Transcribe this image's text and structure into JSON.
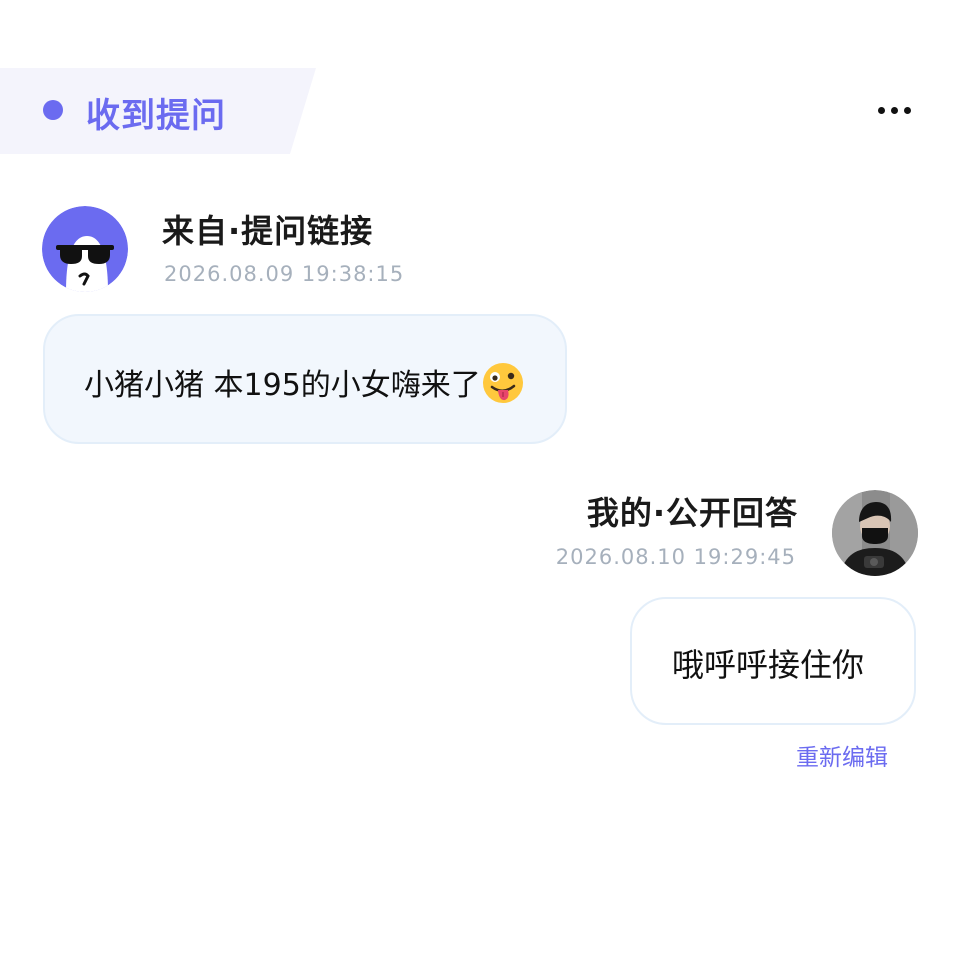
{
  "header": {
    "title": "收到提问",
    "more_icon": "more-horizontal-icon"
  },
  "question": {
    "from_label": "来自·提问链接",
    "timestamp": "2026.08.09 19:38:15",
    "text": "小猪小猪 本195的小女嗨来了",
    "emoji": "zany-face-tongue-emoji",
    "avatar": "cartoon-sunglasses-avatar"
  },
  "answer": {
    "label": "我的·公开回答",
    "timestamp": "2026.08.10 19:29:45",
    "text": "哦呼呼接住你",
    "avatar": "user-photo-avatar",
    "reedit_label": "重新编辑"
  },
  "colors": {
    "accent": "#6B6BF0",
    "header_bg": "#F4F4FC",
    "bubble_bg": "#F2F7FD",
    "bubble_border": "#E3EEF9",
    "timestamp": "#A6B0BC",
    "avatar_bg": "#6B6BF0"
  }
}
